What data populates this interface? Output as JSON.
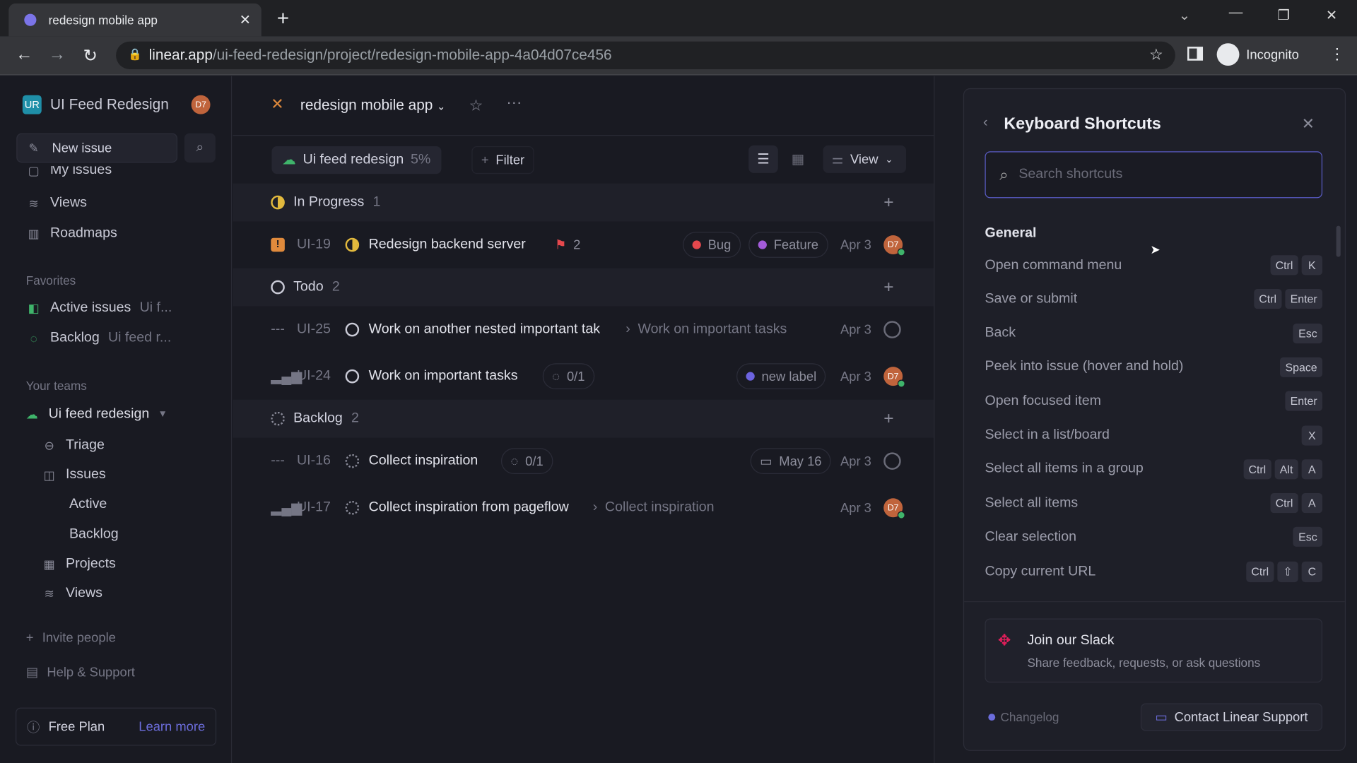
{
  "browser": {
    "tab_title": "redesign mobile app",
    "url_host": "linear.app",
    "url_path": "/ui-feed-redesign/project/redesign-mobile-app-4a04d07ce456",
    "profile": "Incognito"
  },
  "sidebar": {
    "workspace_initials": "UR",
    "workspace": "UI Feed Redesign",
    "user_initials": "D7",
    "new_issue": "New issue",
    "partial_item": "My issues",
    "items": [
      {
        "label": "Views"
      },
      {
        "label": "Roadmaps"
      }
    ],
    "favorites_header": "Favorites",
    "favorites": [
      {
        "label": "Active issues",
        "sub": "Ui f..."
      },
      {
        "label": "Backlog",
        "sub": "Ui feed r..."
      }
    ],
    "teams_header": "Your teams",
    "team": "Ui feed redesign",
    "team_items": [
      "Triage",
      "Issues",
      "Active",
      "Backlog",
      "Projects",
      "Views"
    ],
    "invite": "Invite people",
    "help": "Help & Support",
    "plan": "Free Plan",
    "learn_more": "Learn more"
  },
  "header": {
    "project": "redesign mobile app",
    "project_chip": "Ui feed redesign",
    "progress": "5%",
    "filter": "Filter",
    "view": "View"
  },
  "groups": [
    {
      "name": "In Progress",
      "count": "1",
      "issues": [
        {
          "id": "UI-19",
          "title": "Redesign backend server",
          "sub_count": "2",
          "labels": [
            {
              "name": "Bug",
              "color": "#e5484d"
            },
            {
              "name": "Feature",
              "color": "#a35bd9"
            }
          ],
          "date": "Apr 3",
          "assignee": "D7"
        }
      ]
    },
    {
      "name": "Todo",
      "count": "2",
      "issues": [
        {
          "id": "UI-25",
          "title": "Work on another nested important tak",
          "parent": "Work on important tasks",
          "date": "Apr 3"
        },
        {
          "id": "UI-24",
          "title": "Work on important tasks",
          "subtasks": "0/1",
          "labels": [
            {
              "name": "new label",
              "color": "#6c63e0"
            }
          ],
          "date": "Apr 3",
          "assignee": "D7"
        }
      ]
    },
    {
      "name": "Backlog",
      "count": "2",
      "issues": [
        {
          "id": "UI-16",
          "title": "Collect inspiration",
          "subtasks": "0/1",
          "due": "May 16",
          "date": "Apr 3"
        },
        {
          "id": "UI-17",
          "title": "Collect inspiration from pageflow",
          "parent": "Collect inspiration",
          "date": "Apr 3",
          "assignee": "D7"
        }
      ]
    }
  ],
  "shortcuts": {
    "title": "Keyboard Shortcuts",
    "search_placeholder": "Search shortcuts",
    "section": "General",
    "items": [
      {
        "label": "Open command menu",
        "keys": [
          "Ctrl",
          "K"
        ]
      },
      {
        "label": "Save or submit",
        "keys": [
          "Ctrl",
          "Enter"
        ]
      },
      {
        "label": "Back",
        "keys": [
          "Esc"
        ]
      },
      {
        "label": "Peek into issue (hover and hold)",
        "keys": [
          "Space"
        ]
      },
      {
        "label": "Open focused item",
        "keys": [
          "Enter"
        ]
      },
      {
        "label": "Select in a list/board",
        "keys": [
          "X"
        ]
      },
      {
        "label": "Select all items in a group",
        "keys": [
          "Ctrl",
          "Alt",
          "A"
        ]
      },
      {
        "label": "Select all items",
        "keys": [
          "Ctrl",
          "A"
        ]
      },
      {
        "label": "Clear selection",
        "keys": [
          "Esc"
        ]
      },
      {
        "label": "Copy current URL",
        "keys": [
          "Ctrl",
          "⇧",
          "C"
        ]
      }
    ],
    "slack_title": "Join our Slack",
    "slack_sub": "Share feedback, requests, or ask questions",
    "changelog": "Changelog",
    "contact": "Contact Linear Support"
  }
}
